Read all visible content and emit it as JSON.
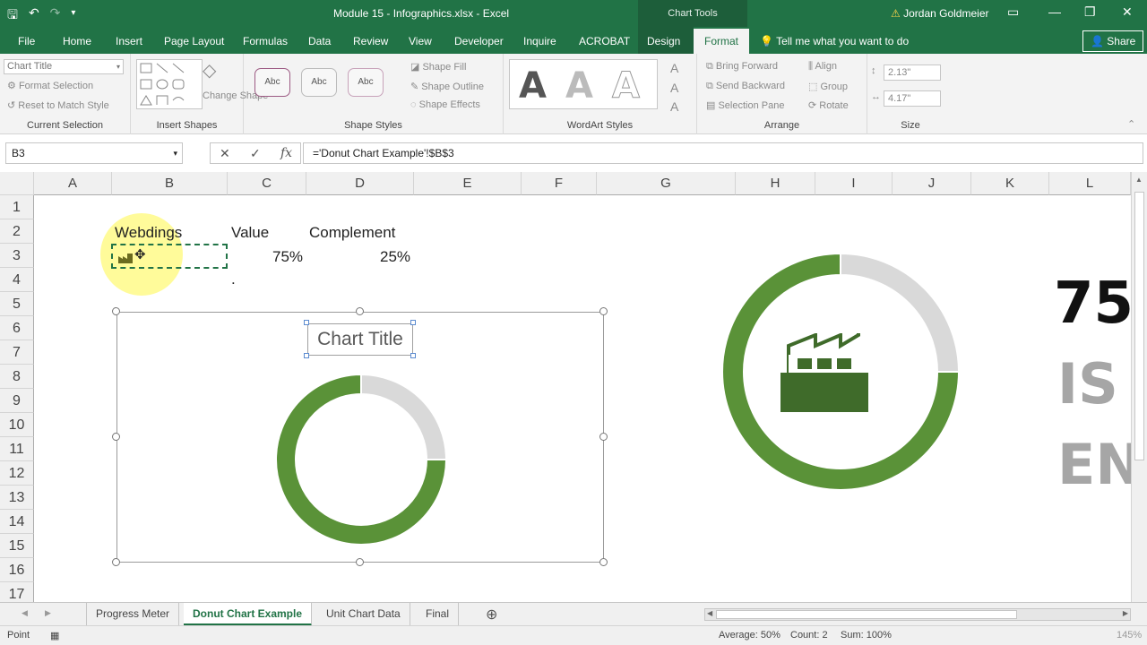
{
  "window": {
    "title": "Module 15 - Infographics.xlsx  -  Excel",
    "context_header": "Chart Tools",
    "user": "Jordan Goldmeier"
  },
  "tabs": [
    "File",
    "Home",
    "Insert",
    "Page Layout",
    "Formulas",
    "Data",
    "Review",
    "View",
    "Developer",
    "Inquire",
    "ACROBAT",
    "Design",
    "Format"
  ],
  "tell_me": "Tell me what you want to do",
  "share": "Share",
  "ribbon": {
    "current_selection": {
      "combo": "Chart Title",
      "format_selection": "Format Selection",
      "reset": "Reset to Match Style",
      "label": "Current Selection"
    },
    "insert_shapes": {
      "change_shape": "Change Shape",
      "label": "Insert Shapes"
    },
    "shape_styles": {
      "samples": [
        "Abc",
        "Abc",
        "Abc"
      ],
      "fill": "Shape Fill",
      "outline": "Shape Outline",
      "effects": "Shape Effects",
      "label": "Shape Styles"
    },
    "wordart": {
      "letters": [
        "A",
        "A",
        "A"
      ],
      "label": "WordArt Styles"
    },
    "arrange": {
      "bring_forward": "Bring Forward",
      "send_backward": "Send Backward",
      "selection_pane": "Selection Pane",
      "align": "Align",
      "group": "Group",
      "rotate": "Rotate",
      "label": "Arrange"
    },
    "size": {
      "height": "2.13\"",
      "width": "4.17\"",
      "label": "Size"
    }
  },
  "formula_bar": {
    "name_box": "B3",
    "formula": "='Donut Chart Example'!$B$3",
    "cancel": "✕",
    "enter": "✓",
    "fx": "fx"
  },
  "columns": [
    "A",
    "B",
    "C",
    "D",
    "E",
    "F",
    "G",
    "H",
    "I",
    "J",
    "K",
    "L"
  ],
  "rows": [
    "1",
    "2",
    "3",
    "4",
    "5",
    "6",
    "7",
    "8",
    "9",
    "10",
    "11",
    "12",
    "13",
    "14",
    "15",
    "16",
    "17"
  ],
  "cells": {
    "b2": "Webdings",
    "c2": "Value",
    "d2": "Complement",
    "c3": "75%",
    "d3": "25%",
    "c4": "."
  },
  "chart": {
    "title": "Chart Title",
    "type": "donut",
    "value_fraction": 0.75,
    "complement_fraction": 0.25,
    "colors": {
      "value": "#5a9238",
      "complement": "#d9d9d9",
      "icon": "#3f6b2a"
    }
  },
  "infographic": {
    "big_number": "75",
    "text_line_1": "IS",
    "text_line_2": "EN"
  },
  "sheets": [
    "Progress Meter",
    "Donut Chart Example",
    "Unit Chart Data",
    "Final"
  ],
  "active_sheet": "Donut Chart Example",
  "status": {
    "mode": "Point",
    "average": "Average: 50%",
    "count": "Count: 2",
    "sum": "Sum: 100%",
    "zoom": "145%"
  },
  "chart_data": {
    "type": "pie",
    "title": "Chart Title",
    "categories": [
      "Value",
      "Complement"
    ],
    "values": [
      0.75,
      0.25
    ]
  }
}
